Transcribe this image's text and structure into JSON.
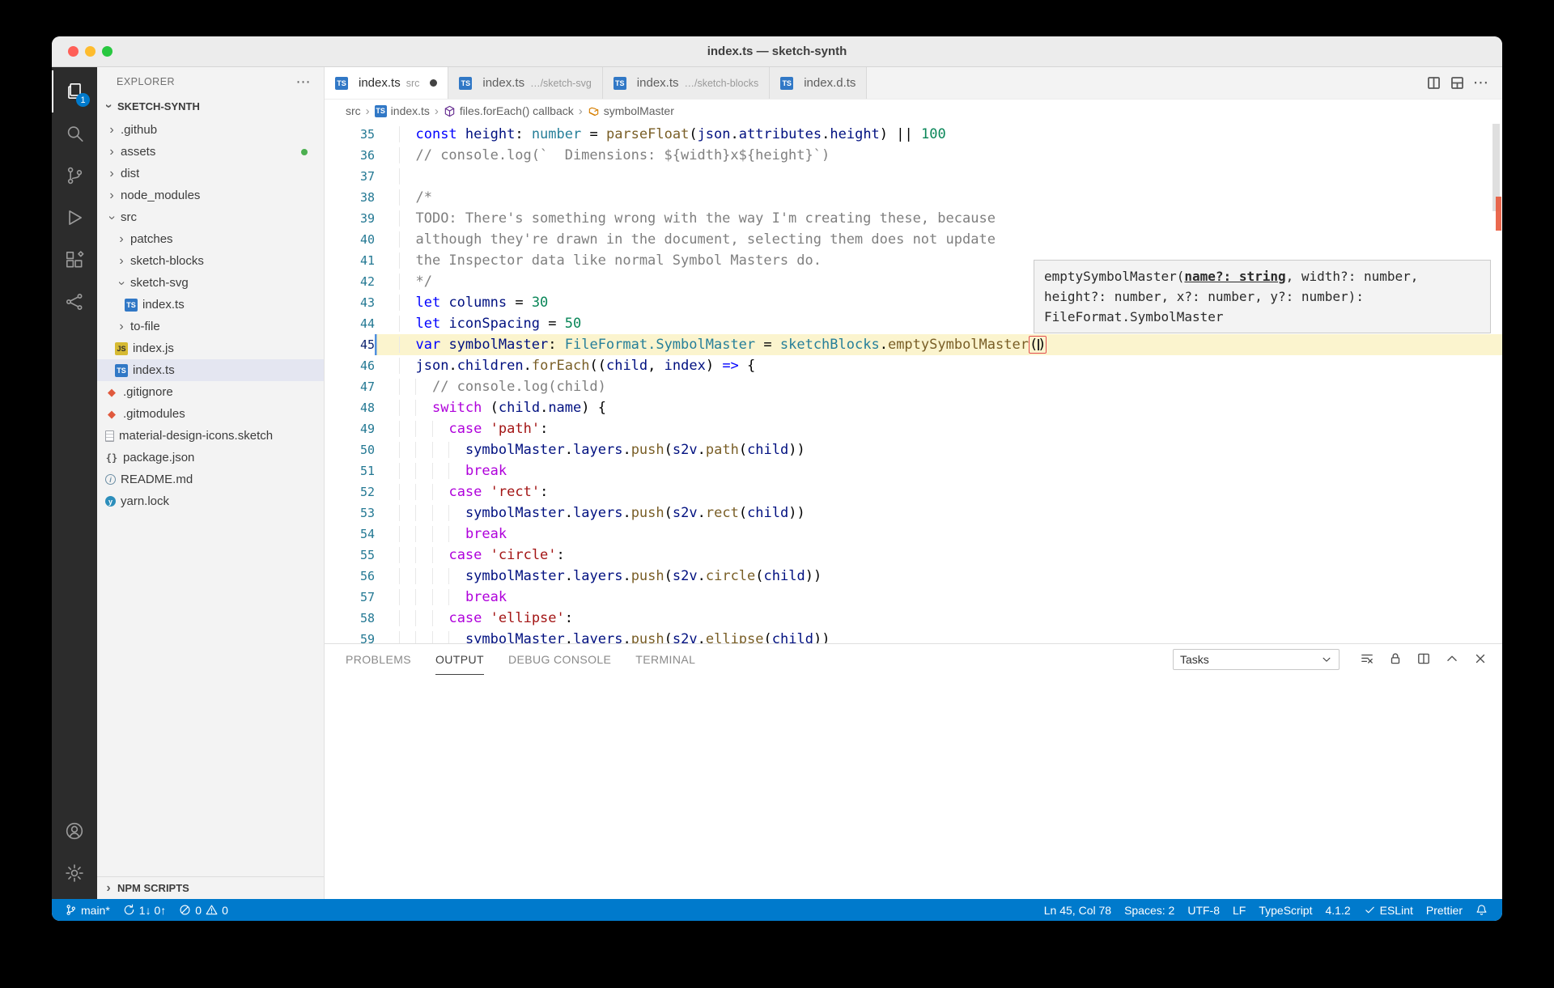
{
  "window": {
    "title": "index.ts — sketch-synth"
  },
  "activity_bar": {
    "items": [
      {
        "name": "explorer",
        "active": true,
        "badge": "1"
      },
      {
        "name": "search"
      },
      {
        "name": "source-control"
      },
      {
        "name": "run-debug"
      },
      {
        "name": "extensions"
      },
      {
        "name": "references"
      }
    ],
    "bottom_items": [
      {
        "name": "account"
      },
      {
        "name": "settings"
      }
    ]
  },
  "sidebar": {
    "title": "EXPLORER",
    "section": "SKETCH-SYNTH",
    "bottom_section": "NPM SCRIPTS",
    "tree": [
      {
        "label": ".github",
        "kind": "folder",
        "level": 0,
        "expanded": false
      },
      {
        "label": "assets",
        "kind": "folder",
        "level": 0,
        "expanded": false,
        "dot": true
      },
      {
        "label": "dist",
        "kind": "folder",
        "level": 0,
        "expanded": false
      },
      {
        "label": "node_modules",
        "kind": "folder",
        "level": 0,
        "expanded": false
      },
      {
        "label": "src",
        "kind": "folder",
        "level": 0,
        "expanded": true
      },
      {
        "label": "patches",
        "kind": "folder",
        "level": 1,
        "expanded": false
      },
      {
        "label": "sketch-blocks",
        "kind": "folder",
        "level": 1,
        "expanded": false
      },
      {
        "label": "sketch-svg",
        "kind": "folder",
        "level": 1,
        "expanded": true
      },
      {
        "label": "index.ts",
        "kind": "file",
        "icon": "ts",
        "level": 2
      },
      {
        "label": "to-file",
        "kind": "folder",
        "level": 1,
        "expanded": false
      },
      {
        "label": "index.js",
        "kind": "file",
        "icon": "js",
        "level": 1
      },
      {
        "label": "index.ts",
        "kind": "file",
        "icon": "ts",
        "level": 1,
        "selected": true
      },
      {
        "label": ".gitignore",
        "kind": "file",
        "icon": "git",
        "level": 0
      },
      {
        "label": ".gitmodules",
        "kind": "file",
        "icon": "git",
        "level": 0
      },
      {
        "label": "material-design-icons.sketch",
        "kind": "file",
        "icon": "doc",
        "level": 0
      },
      {
        "label": "package.json",
        "kind": "file",
        "icon": "json",
        "level": 0
      },
      {
        "label": "README.md",
        "kind": "file",
        "icon": "info",
        "level": 0
      },
      {
        "label": "yarn.lock",
        "kind": "file",
        "icon": "yarn",
        "level": 0
      }
    ]
  },
  "editor_tabs": [
    {
      "icon": "ts",
      "label": "index.ts",
      "desc": "src",
      "modified": true,
      "active": true
    },
    {
      "icon": "ts",
      "label": "index.ts",
      "desc": "…/sketch-svg"
    },
    {
      "icon": "ts",
      "label": "index.ts",
      "desc": "…/sketch-blocks"
    },
    {
      "icon": "ts",
      "label": "index.d.ts"
    }
  ],
  "breadcrumbs": [
    {
      "label": "src"
    },
    {
      "label": "index.ts",
      "icon": "ts"
    },
    {
      "label": "files.forEach() callback",
      "icon": "method"
    },
    {
      "label": "symbolMaster",
      "icon": "field"
    }
  ],
  "editor": {
    "active_line": 45,
    "lines": [
      {
        "n": 35,
        "i": 1,
        "segs": [
          [
            "k",
            "const "
          ],
          [
            "v",
            "height"
          ],
          [
            "o",
            ": "
          ],
          [
            "t",
            "number"
          ],
          [
            "o",
            " = "
          ],
          [
            "f",
            "parseFloat"
          ],
          [
            "o",
            "("
          ],
          [
            "v",
            "json"
          ],
          [
            "o",
            "."
          ],
          [
            "v",
            "attributes"
          ],
          [
            "o",
            "."
          ],
          [
            "v",
            "height"
          ],
          [
            "o",
            ") || "
          ],
          [
            "n",
            "100"
          ]
        ]
      },
      {
        "n": 36,
        "i": 1,
        "segs": [
          [
            "m",
            "// console.log(`  Dimensions: ${width}x${height}`)"
          ]
        ]
      },
      {
        "n": 37,
        "i": 1,
        "segs": []
      },
      {
        "n": 38,
        "i": 1,
        "segs": [
          [
            "m",
            "/*"
          ]
        ]
      },
      {
        "n": 39,
        "i": 1,
        "segs": [
          [
            "m",
            "TODO: There's something wrong with the way I'm creating these, because"
          ]
        ]
      },
      {
        "n": 40,
        "i": 1,
        "segs": [
          [
            "m",
            "although they're drawn in the document, selecting them does not update"
          ]
        ]
      },
      {
        "n": 41,
        "i": 1,
        "segs": [
          [
            "m",
            "the Inspector data like normal Symbol Masters do."
          ]
        ]
      },
      {
        "n": 42,
        "i": 1,
        "segs": [
          [
            "m",
            "*/"
          ]
        ]
      },
      {
        "n": 43,
        "i": 1,
        "segs": [
          [
            "k",
            "let "
          ],
          [
            "v",
            "columns"
          ],
          [
            "o",
            " = "
          ],
          [
            "n",
            "30"
          ]
        ]
      },
      {
        "n": 44,
        "i": 1,
        "segs": [
          [
            "k",
            "let "
          ],
          [
            "v",
            "iconSpacing"
          ],
          [
            "o",
            " = "
          ],
          [
            "n",
            "50"
          ]
        ]
      },
      {
        "n": 45,
        "i": 1,
        "segs": [
          [
            "k",
            "var "
          ],
          [
            "v",
            "symbolMaster"
          ],
          [
            "o",
            ": "
          ],
          [
            "t",
            "FileFormat.SymbolMaster"
          ],
          [
            "o",
            " = "
          ],
          [
            "t",
            "sketchBlocks"
          ],
          [
            "o",
            "."
          ],
          [
            "f",
            "emptySymbolMaster"
          ],
          [
            "x",
            "()"
          ]
        ]
      },
      {
        "n": 46,
        "i": 1,
        "segs": [
          [
            "v",
            "json"
          ],
          [
            "o",
            "."
          ],
          [
            "v",
            "children"
          ],
          [
            "o",
            "."
          ],
          [
            "f",
            "forEach"
          ],
          [
            "o",
            "(("
          ],
          [
            "v",
            "child"
          ],
          [
            "o",
            ", "
          ],
          [
            "v",
            "index"
          ],
          [
            "o",
            ") "
          ],
          [
            "k",
            "=>"
          ],
          [
            "o",
            " {"
          ]
        ]
      },
      {
        "n": 47,
        "i": 2,
        "segs": [
          [
            "m",
            "// console.log(child)"
          ]
        ]
      },
      {
        "n": 48,
        "i": 2,
        "segs": [
          [
            "c",
            "switch"
          ],
          [
            "o",
            " ("
          ],
          [
            "v",
            "child"
          ],
          [
            "o",
            "."
          ],
          [
            "v",
            "name"
          ],
          [
            "o",
            ") {"
          ]
        ]
      },
      {
        "n": 49,
        "i": 3,
        "segs": [
          [
            "c",
            "case "
          ],
          [
            "s",
            "'path'"
          ],
          [
            "o",
            ":"
          ]
        ]
      },
      {
        "n": 50,
        "i": 4,
        "segs": [
          [
            "v",
            "symbolMaster"
          ],
          [
            "o",
            "."
          ],
          [
            "v",
            "layers"
          ],
          [
            "o",
            "."
          ],
          [
            "f",
            "push"
          ],
          [
            "o",
            "("
          ],
          [
            "v",
            "s2v"
          ],
          [
            "o",
            "."
          ],
          [
            "f",
            "path"
          ],
          [
            "o",
            "("
          ],
          [
            "v",
            "child"
          ],
          [
            "o",
            "))"
          ]
        ]
      },
      {
        "n": 51,
        "i": 4,
        "segs": [
          [
            "c",
            "break"
          ]
        ]
      },
      {
        "n": 52,
        "i": 3,
        "segs": [
          [
            "c",
            "case "
          ],
          [
            "s",
            "'rect'"
          ],
          [
            "o",
            ":"
          ]
        ]
      },
      {
        "n": 53,
        "i": 4,
        "segs": [
          [
            "v",
            "symbolMaster"
          ],
          [
            "o",
            "."
          ],
          [
            "v",
            "layers"
          ],
          [
            "o",
            "."
          ],
          [
            "f",
            "push"
          ],
          [
            "o",
            "("
          ],
          [
            "v",
            "s2v"
          ],
          [
            "o",
            "."
          ],
          [
            "f",
            "rect"
          ],
          [
            "o",
            "("
          ],
          [
            "v",
            "child"
          ],
          [
            "o",
            "))"
          ]
        ]
      },
      {
        "n": 54,
        "i": 4,
        "segs": [
          [
            "c",
            "break"
          ]
        ]
      },
      {
        "n": 55,
        "i": 3,
        "segs": [
          [
            "c",
            "case "
          ],
          [
            "s",
            "'circle'"
          ],
          [
            "o",
            ":"
          ]
        ]
      },
      {
        "n": 56,
        "i": 4,
        "segs": [
          [
            "v",
            "symbolMaster"
          ],
          [
            "o",
            "."
          ],
          [
            "v",
            "layers"
          ],
          [
            "o",
            "."
          ],
          [
            "f",
            "push"
          ],
          [
            "o",
            "("
          ],
          [
            "v",
            "s2v"
          ],
          [
            "o",
            "."
          ],
          [
            "f",
            "circle"
          ],
          [
            "o",
            "("
          ],
          [
            "v",
            "child"
          ],
          [
            "o",
            "))"
          ]
        ]
      },
      {
        "n": 57,
        "i": 4,
        "segs": [
          [
            "c",
            "break"
          ]
        ]
      },
      {
        "n": 58,
        "i": 3,
        "segs": [
          [
            "c",
            "case "
          ],
          [
            "s",
            "'ellipse'"
          ],
          [
            "o",
            ":"
          ]
        ]
      },
      {
        "n": 59,
        "i": 4,
        "segs": [
          [
            "v",
            "symbolMaster"
          ],
          [
            "o",
            "."
          ],
          [
            "v",
            "layers"
          ],
          [
            "o",
            "."
          ],
          [
            "f",
            "push"
          ],
          [
            "o",
            "("
          ],
          [
            "v",
            "s2v"
          ],
          [
            "o",
            "."
          ],
          [
            "f",
            "ellipse"
          ],
          [
            "o",
            "("
          ],
          [
            "v",
            "child"
          ],
          [
            "o",
            "))"
          ]
        ]
      }
    ]
  },
  "hover": {
    "lines": [
      [
        [
          "",
          "emptySymbolMaster("
        ],
        [
          "b",
          "name?: string"
        ],
        [
          "",
          ", width?: number,"
        ]
      ],
      [
        [
          "",
          "height?: number, x?: number, y?: number):"
        ]
      ],
      [
        [
          "",
          "FileFormat.SymbolMaster"
        ]
      ]
    ]
  },
  "panel": {
    "tabs": [
      {
        "label": "PROBLEMS"
      },
      {
        "label": "OUTPUT",
        "active": true
      },
      {
        "label": "DEBUG CONSOLE"
      },
      {
        "label": "TERMINAL"
      }
    ],
    "dropdown": "Tasks",
    "actions": [
      "clear-output",
      "lock",
      "open-in-editor",
      "maximize-panel",
      "close-panel"
    ]
  },
  "status_bar": {
    "branch": "main*",
    "sync": "1↓ 0↑",
    "problems": {
      "errors": "0",
      "warnings": "0"
    },
    "right": [
      {
        "label": "Ln 45, Col 78"
      },
      {
        "label": "Spaces: 2"
      },
      {
        "label": "UTF-8"
      },
      {
        "label": "LF"
      },
      {
        "label": "TypeScript"
      },
      {
        "label": "4.1.2"
      },
      {
        "label": "ESLint",
        "icon": "check"
      },
      {
        "label": "Prettier"
      },
      {
        "icon": "bell"
      }
    ]
  },
  "colors": {
    "accent": "#007ACC",
    "modified_dot": "#4CAF50",
    "current_line": "#FBF4CE"
  }
}
